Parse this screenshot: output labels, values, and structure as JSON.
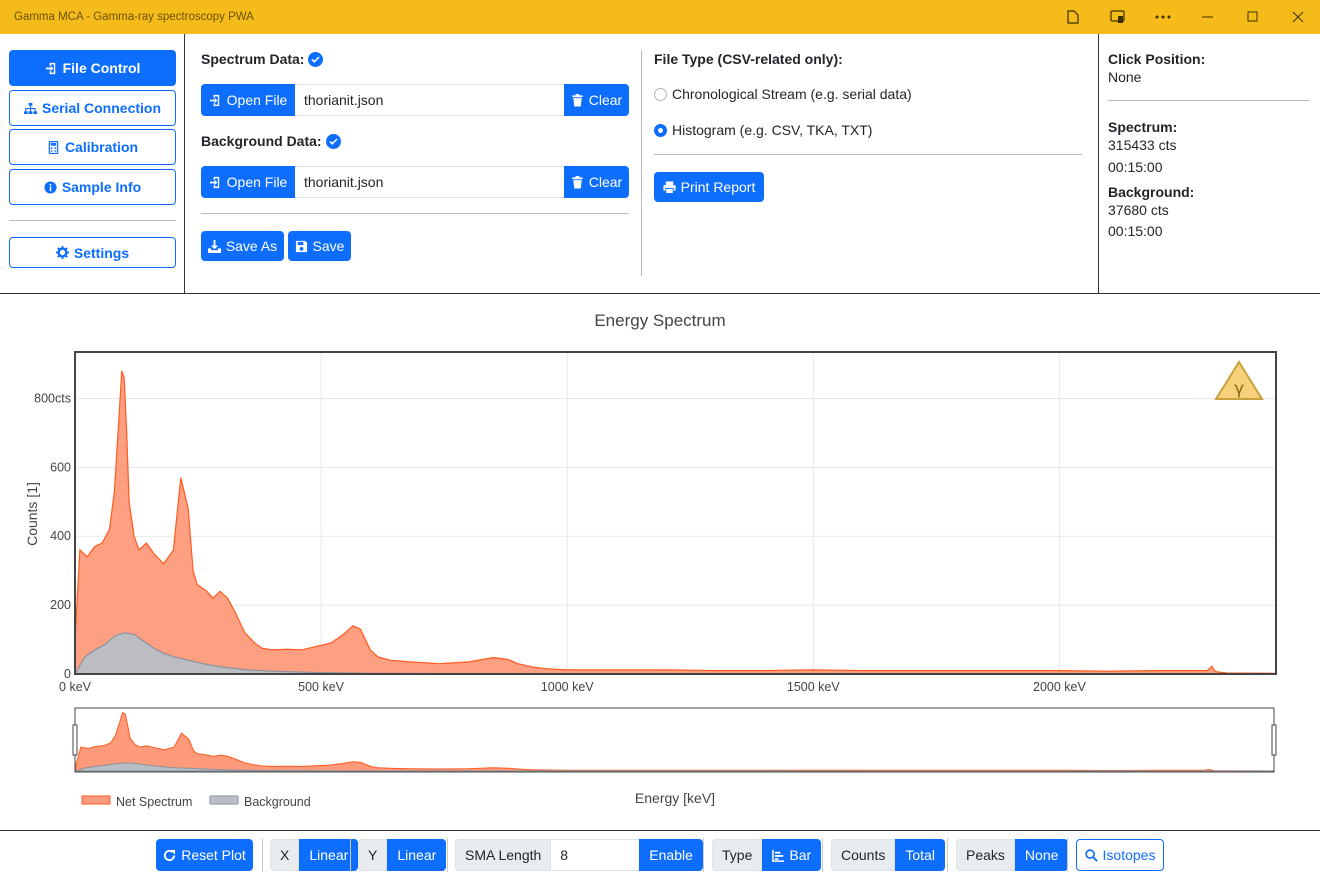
{
  "window": {
    "title": "Gamma MCA - Gamma-ray spectroscopy PWA"
  },
  "nav": {
    "file_control": "File Control",
    "serial_connection": "Serial Connection",
    "calibration": "Calibration",
    "sample_info": "Sample Info",
    "settings": "Settings"
  },
  "files": {
    "spectrum_label": "Spectrum Data:",
    "background_label": "Background Data:",
    "open_label": "Open File",
    "clear_label": "Clear",
    "spectrum_file": "thorianit.json",
    "background_file": "thorianit.json",
    "save_as_label": "Save As",
    "save_label": "Save"
  },
  "file_type": {
    "label": "File Type (CSV-related only):",
    "options": [
      "Chronological Stream (e.g. serial data)",
      "Histogram (e.g. CSV, TKA, TXT)"
    ],
    "selected": "Histogram (e.g. CSV, TKA, TXT)",
    "print_label": "Print Report"
  },
  "info": {
    "click_label": "Click Position:",
    "click_value": "None",
    "spectrum_label": "Spectrum:",
    "spectrum_counts": "315433 cts",
    "spectrum_time": "00:15:00",
    "background_label": "Background:",
    "background_counts": "37680 cts",
    "background_time": "00:15:00"
  },
  "chart_data": {
    "type": "area",
    "title": "Energy Spectrum",
    "xlabel": "Energy [keV]",
    "ylabel": "Counts [1]",
    "xlim": [
      0,
      2440
    ],
    "ylim": [
      0,
      935
    ],
    "x_ticks": [
      {
        "value": 0,
        "label": "0 keV"
      },
      {
        "value": 500,
        "label": "500 keV"
      },
      {
        "value": 1000,
        "label": "1000 keV"
      },
      {
        "value": 1500,
        "label": "1500 keV"
      },
      {
        "value": 2000,
        "label": "2000 keV"
      }
    ],
    "y_ticks": [
      {
        "value": 0,
        "label": "0"
      },
      {
        "value": 200,
        "label": "200"
      },
      {
        "value": 400,
        "label": "400"
      },
      {
        "value": 600,
        "label": "600"
      },
      {
        "value": 800,
        "label": "800cts"
      }
    ],
    "grid": true,
    "legend_position": "bottom-left",
    "series": [
      {
        "name": "Net Spectrum",
        "color": "#ff9a7a",
        "line_color": "#ff5a1f",
        "x": [
          0,
          10,
          25,
          40,
          55,
          70,
          80,
          90,
          95,
          100,
          105,
          110,
          120,
          130,
          145,
          160,
          180,
          200,
          215,
          230,
          240,
          248,
          258,
          268,
          280,
          295,
          310,
          325,
          345,
          365,
          380,
          400,
          430,
          460,
          490,
          520,
          545,
          565,
          580,
          590,
          600,
          615,
          640,
          680,
          740,
          800,
          850,
          880,
          900,
          930,
          960,
          1000,
          1100,
          1200,
          1300,
          1400,
          1500,
          1600,
          1700,
          1800,
          1900,
          2000,
          2100,
          2200,
          2300,
          2310,
          2315,
          2320,
          2340,
          2440
        ],
        "values": [
          100,
          360,
          340,
          370,
          380,
          420,
          530,
          760,
          880,
          860,
          700,
          500,
          400,
          360,
          380,
          350,
          320,
          360,
          570,
          480,
          300,
          260,
          250,
          240,
          220,
          240,
          220,
          180,
          120,
          90,
          75,
          70,
          72,
          70,
          80,
          90,
          115,
          140,
          130,
          100,
          70,
          50,
          40,
          35,
          30,
          35,
          48,
          42,
          30,
          20,
          15,
          12,
          12,
          12,
          10,
          10,
          12,
          10,
          10,
          10,
          10,
          10,
          8,
          10,
          10,
          22,
          10,
          6,
          3,
          2
        ]
      },
      {
        "name": "Background",
        "color": "#b8bec6",
        "line_color": "#8a929c",
        "x": [
          0,
          20,
          40,
          60,
          80,
          100,
          120,
          140,
          160,
          180,
          200,
          230,
          260,
          300,
          350,
          400,
          500,
          600,
          800,
          2440
        ],
        "values": [
          0,
          50,
          70,
          85,
          110,
          120,
          115,
          95,
          75,
          60,
          50,
          40,
          30,
          20,
          12,
          8,
          4,
          2,
          1,
          0
        ]
      }
    ]
  },
  "toolbar": {
    "reset_label": "Reset Plot",
    "x_label": "X",
    "x_value": "Linear",
    "y_label": "Y",
    "y_value": "Linear",
    "sma_label": "SMA Length",
    "sma_value": "8",
    "sma_button": "Enable",
    "type_label": "Type",
    "type_value": "Bar",
    "counts_label": "Counts",
    "counts_value": "Total",
    "peaks_label": "Peaks",
    "peaks_value": "None",
    "isotopes_label": "Isotopes"
  }
}
